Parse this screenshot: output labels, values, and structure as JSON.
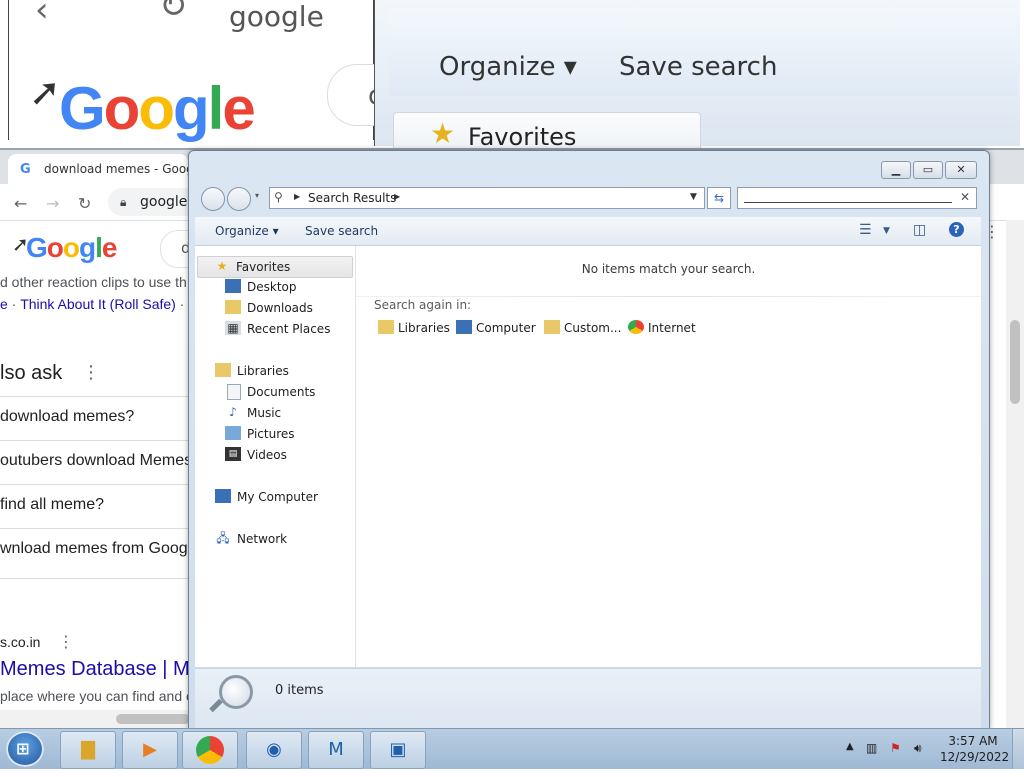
{
  "zoom": {
    "organize": "Organize",
    "save_search": "Save search",
    "favorites": "Favorites",
    "url_fragment": "google",
    "google_logo": "Google",
    "search_letter": "d"
  },
  "chrome": {
    "tab_title": "download memes - Google",
    "tab_favicon": "G",
    "url": "google",
    "google_logo": "Google",
    "search_letter": "d",
    "snippet_line": "d other reaction clips to use th",
    "link_prefix": "e",
    "link_text": "Think About It (Roll Safe)",
    "link_sep": "·",
    "paa_title": "lso ask",
    "paa_items": [
      "download memes?",
      "outubers download Memes",
      "find all meme?",
      "wnload memes from Goog"
    ],
    "site": "s.co.in",
    "result_title": "Memes Database | Me",
    "result_snippet": "place where you can find and c"
  },
  "explorer": {
    "breadcrumb": "Search Results",
    "search_value": "",
    "organize": "Organize",
    "save_search": "Save search",
    "nav": {
      "favorites": "Favorites",
      "desktop": "Desktop",
      "downloads": "Downloads",
      "recent": "Recent Places",
      "libraries": "Libraries",
      "documents": "Documents",
      "music": "Music",
      "pictures": "Pictures",
      "videos": "Videos",
      "computer": "My Computer",
      "network": "Network"
    },
    "no_items": "No items match your search.",
    "search_again": "Search again in:",
    "search_locations": [
      "Libraries",
      "Computer",
      "Custom...",
      "Internet"
    ],
    "item_count": "0 items"
  },
  "taskbar": {
    "time": "3:57 AM",
    "date": "12/29/2022"
  }
}
